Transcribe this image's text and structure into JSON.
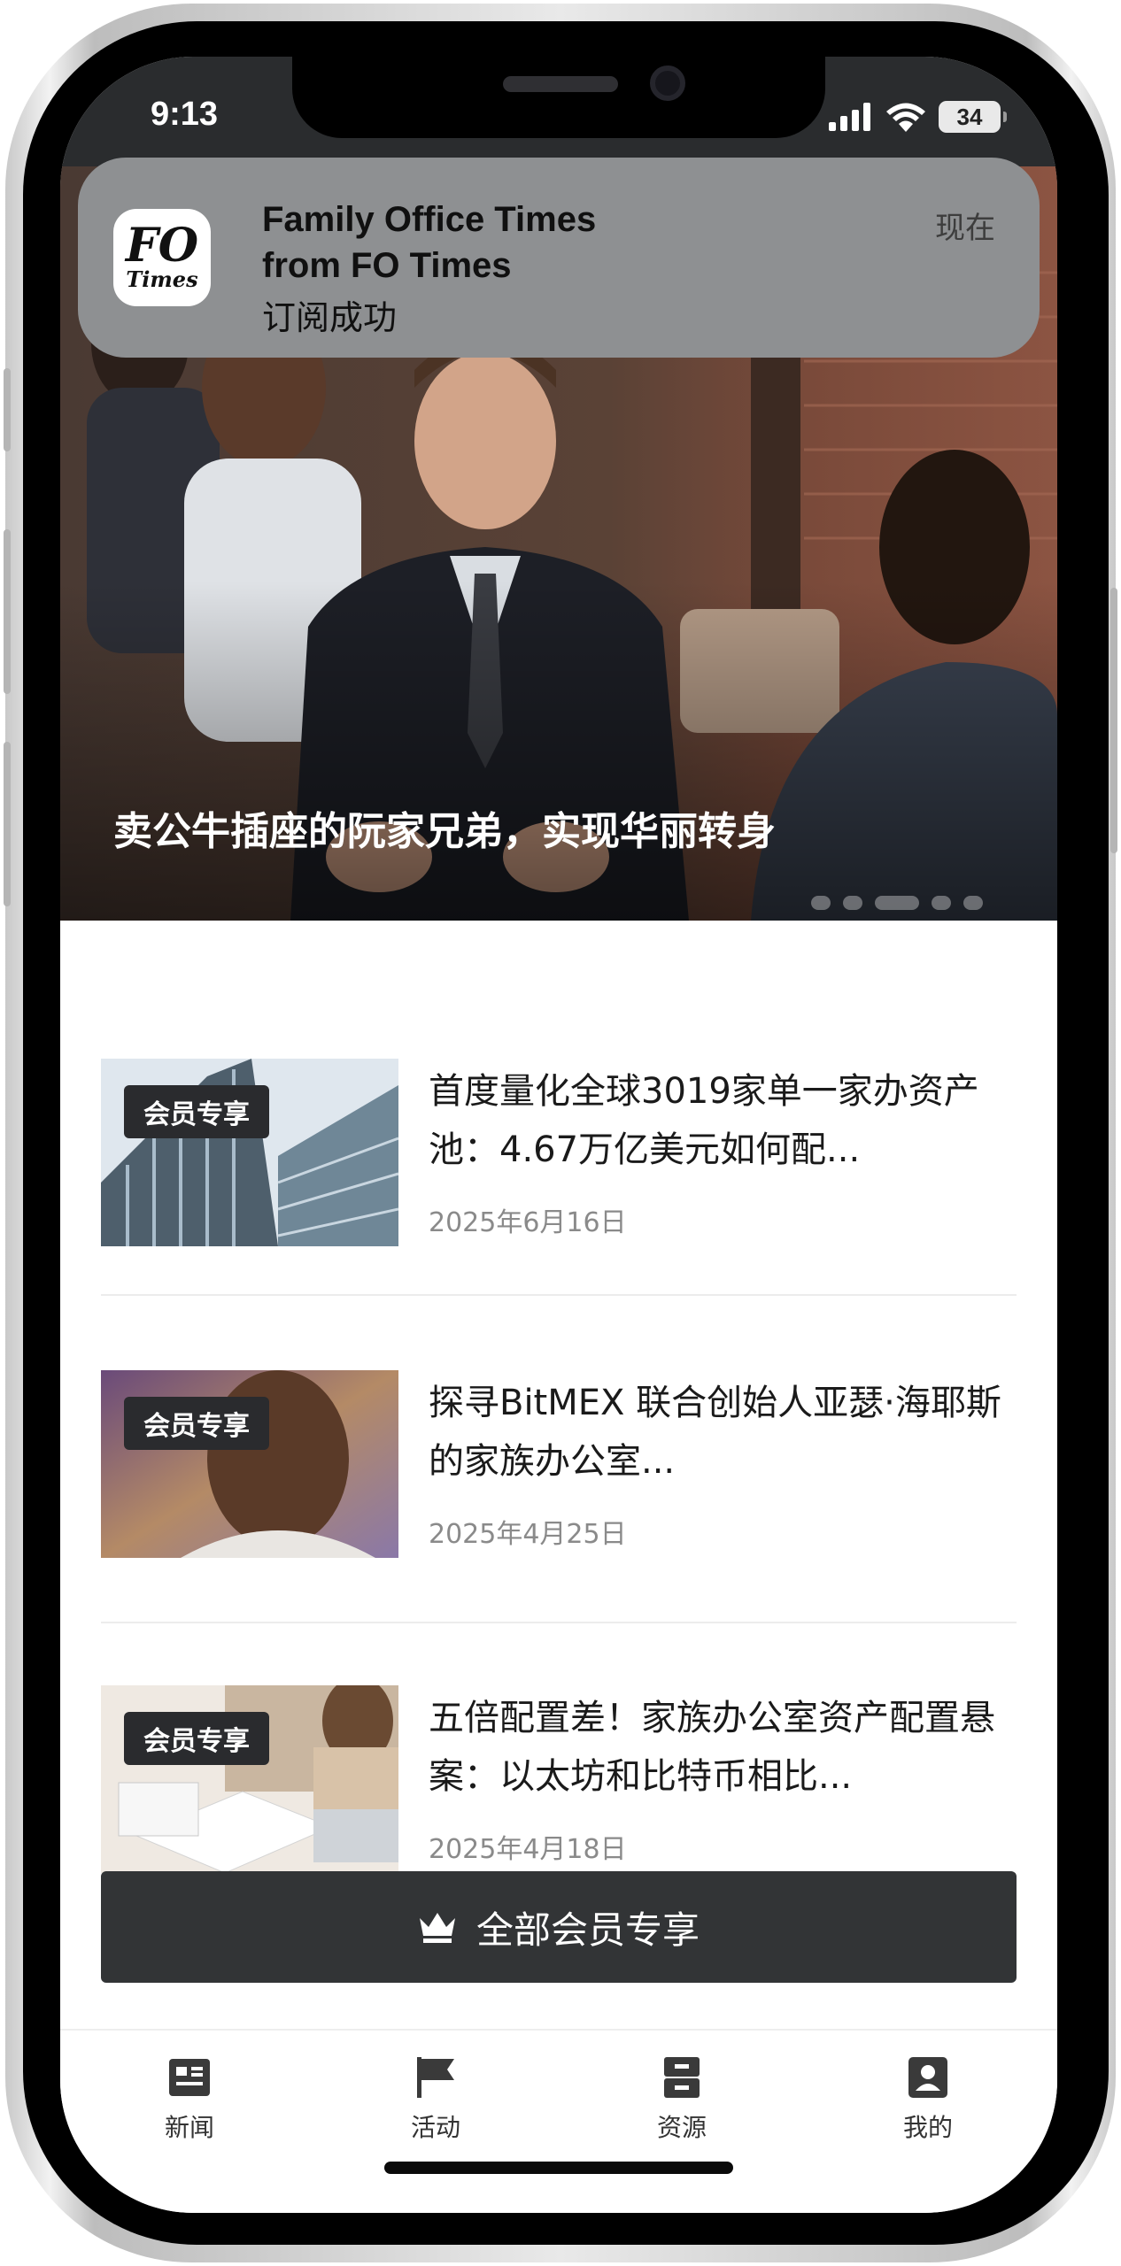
{
  "status_bar": {
    "time": "9:13",
    "battery": "34",
    "icons": [
      "signal-icon",
      "wifi-icon",
      "battery-icon"
    ]
  },
  "notification": {
    "app_icon": "fo-times-logo",
    "logo_text": [
      "FO",
      "Times"
    ],
    "title_line1": "Family Office Times",
    "title_line2": "from FO Times",
    "body": "订阅成功",
    "time": "现在"
  },
  "hero": {
    "title": "卖公牛插座的阮家兄弟，实现华丽转身",
    "dots": 5,
    "active_dot": 3
  },
  "articles": [
    {
      "badge": "会员专享",
      "title": "首度量化全球3019家单一家办资产池：4.67万亿美元如何配...",
      "date": "2025年6月16日"
    },
    {
      "badge": "会员专享",
      "title": "探寻BitMEX 联合创始人亚瑟·海耶斯的家族办公室...",
      "date": "2025年4月25日"
    },
    {
      "badge": "会员专享",
      "title": "五倍配置差！家族办公室资产配置悬案：以太坊和比特币相比...",
      "date": "2025年4月18日"
    }
  ],
  "all_members_button": {
    "label": "全部会员专享",
    "icon": "crown-icon"
  },
  "tabbar": [
    {
      "label": "新闻",
      "icon": "news-icon"
    },
    {
      "label": "活动",
      "icon": "flag-icon"
    },
    {
      "label": "资源",
      "icon": "resources-icon"
    },
    {
      "label": "我的",
      "icon": "profile-icon"
    }
  ],
  "colors": {
    "dark_button": "#323436",
    "badge_bg": "#2a2b2e",
    "notification_bg": "#8e9092",
    "date_text": "#8a8a8a"
  }
}
